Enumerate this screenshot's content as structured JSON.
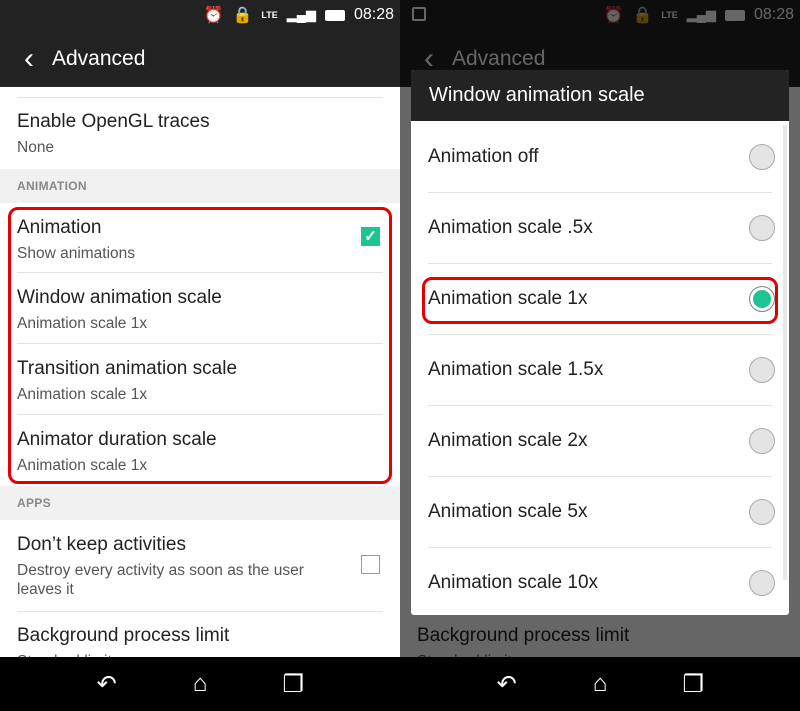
{
  "status": {
    "time": "08:28",
    "network": "LTE",
    "icons": [
      "alarm-icon",
      "lock-icon",
      "lte-icon",
      "signal-icon",
      "battery-icon"
    ]
  },
  "header": {
    "title": "Advanced",
    "back_icon": "chevron-left-icon"
  },
  "settings": {
    "opengl": {
      "title": "Enable OpenGL traces",
      "value": "None"
    },
    "section_animation": "ANIMATION",
    "animation": {
      "title": "Animation",
      "subtitle": "Show animations",
      "checked": true
    },
    "window_scale": {
      "title": "Window animation scale",
      "value": "Animation scale 1x"
    },
    "transition_scale": {
      "title": "Transition animation scale",
      "value": "Animation scale 1x"
    },
    "animator_scale": {
      "title": "Animator duration scale",
      "value": "Animation scale 1x"
    },
    "section_apps": "APPS",
    "dont_keep": {
      "title": "Don’t keep activities",
      "subtitle": "Destroy every activity as soon as the user leaves it",
      "checked": false
    },
    "bg_limit": {
      "title": "Background process limit",
      "value": "Standard limit"
    }
  },
  "dialog": {
    "title": "Window animation scale",
    "options": [
      {
        "label": "Animation off",
        "selected": false
      },
      {
        "label": "Animation scale .5x",
        "selected": false
      },
      {
        "label": "Animation scale 1x",
        "selected": true
      },
      {
        "label": "Animation scale 1.5x",
        "selected": false
      },
      {
        "label": "Animation scale 2x",
        "selected": false
      },
      {
        "label": "Animation scale 5x",
        "selected": false
      },
      {
        "label": "Animation scale 10x",
        "selected": false
      }
    ]
  },
  "navbar": {
    "back": "↶",
    "home": "⌂",
    "recents": "❐"
  },
  "colors": {
    "accent": "#1ec592",
    "highlight": "#e50000",
    "bar": "#222222"
  }
}
